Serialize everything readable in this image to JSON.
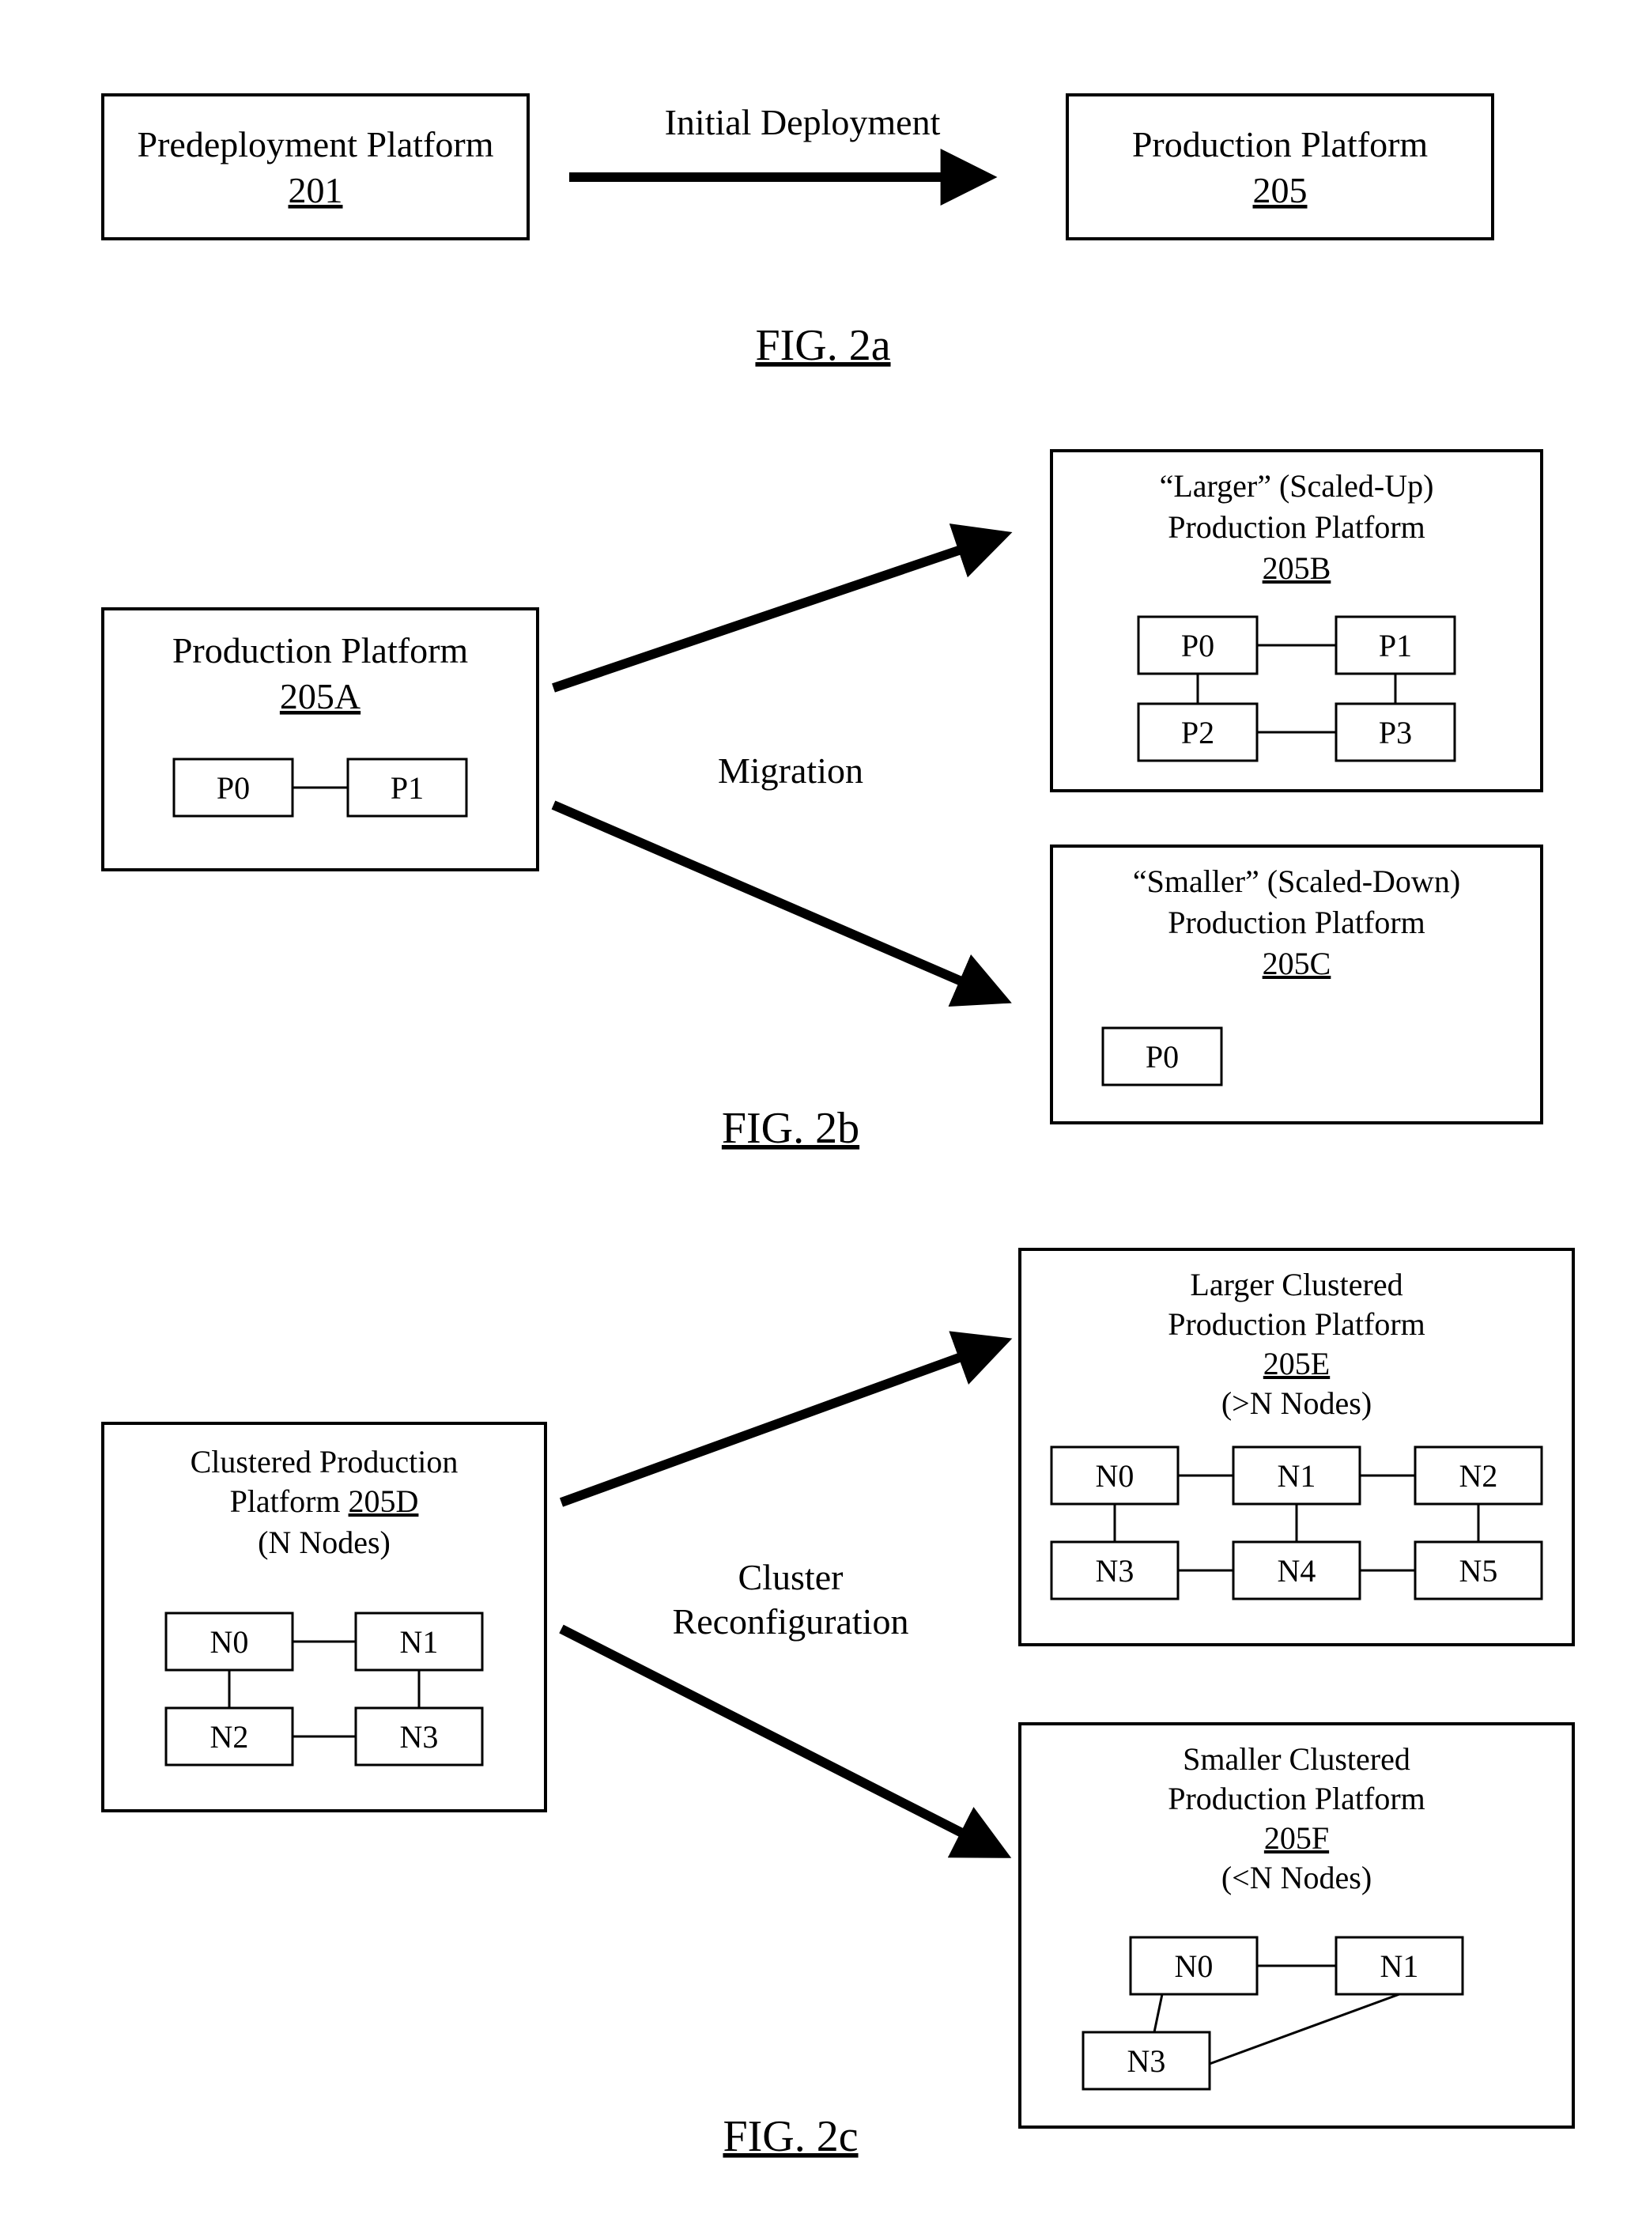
{
  "fig2a": {
    "caption": "FIG. 2a",
    "left_box": {
      "title": "Predeployment Platform",
      "ref": "201"
    },
    "arrow_label": "Initial Deployment",
    "right_box": {
      "title": "Production Platform",
      "ref": "205"
    }
  },
  "fig2b": {
    "caption": "FIG. 2b",
    "center_label": "Migration",
    "left_box": {
      "title": "Production Platform",
      "ref": "205A",
      "nodes": [
        "P0",
        "P1"
      ]
    },
    "top_box": {
      "title1": "“Larger” (Scaled-Up)",
      "title2": "Production Platform",
      "ref": "205B",
      "nodes": [
        "P0",
        "P1",
        "P2",
        "P3"
      ]
    },
    "bottom_box": {
      "title1": "“Smaller” (Scaled-Down)",
      "title2": "Production Platform",
      "ref": "205C",
      "nodes": [
        "P0"
      ]
    }
  },
  "fig2c": {
    "caption": "FIG. 2c",
    "center_label1": "Cluster",
    "center_label2": "Reconfiguration",
    "left_box": {
      "title1": "Clustered Production",
      "title2_prefix": "Platform ",
      "ref": "205D",
      "subtitle": "(N Nodes)",
      "nodes": [
        "N0",
        "N1",
        "N2",
        "N3"
      ]
    },
    "top_box": {
      "title1": "Larger Clustered",
      "title2": "Production Platform",
      "ref": "205E",
      "subtitle": "(>N Nodes)",
      "nodes": [
        "N0",
        "N1",
        "N2",
        "N3",
        "N4",
        "N5"
      ]
    },
    "bottom_box": {
      "title1": "Smaller Clustered",
      "title2": "Production Platform",
      "ref": "205F",
      "subtitle": "(<N Nodes)",
      "nodes": [
        "N0",
        "N1",
        "N3"
      ]
    }
  }
}
